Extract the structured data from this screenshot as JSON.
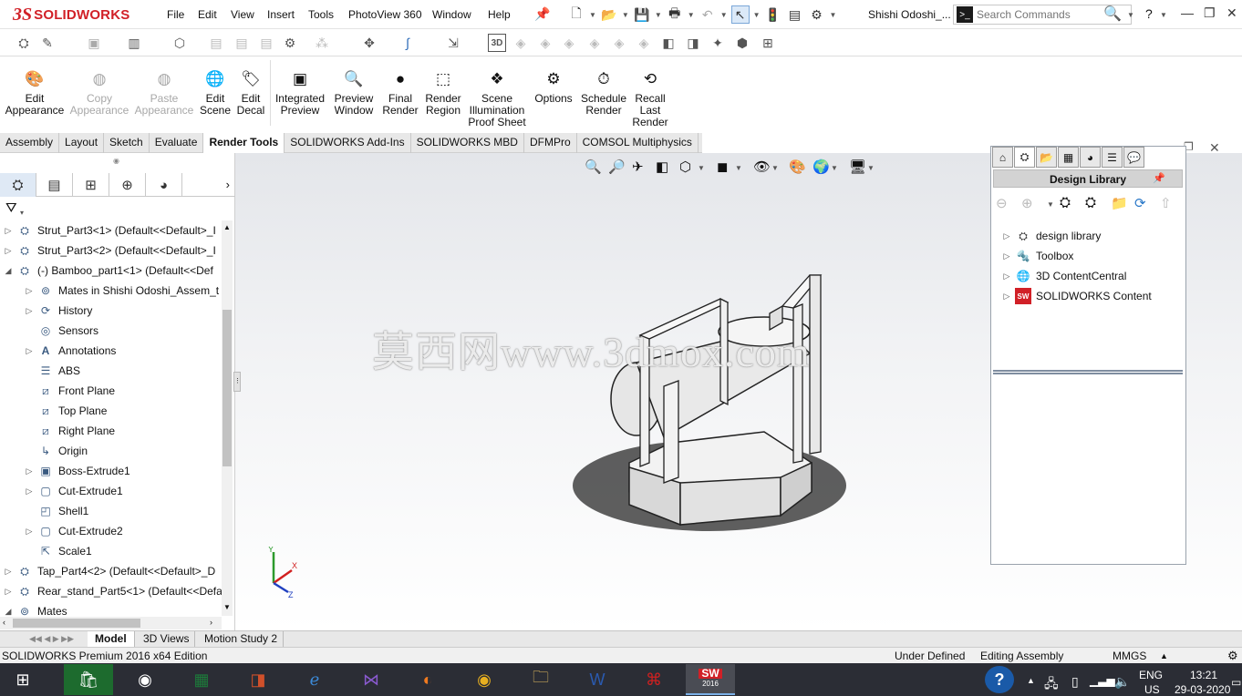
{
  "app": {
    "logo_ds": "3S",
    "logo_text": "SOLIDWORKS"
  },
  "menu": [
    "File",
    "Edit",
    "View",
    "Insert",
    "Tools",
    "PhotoView 360",
    "Window",
    "Help"
  ],
  "document_title": "Shishi Odoshi_...",
  "search": {
    "placeholder": "Search Commands"
  },
  "help": "?",
  "ribbon": [
    {
      "label": "Edit Appearance",
      "enabled": true
    },
    {
      "label": "Copy Appearance",
      "enabled": false
    },
    {
      "label": "Paste Appearance",
      "enabled": false
    },
    {
      "label": "Edit Scene",
      "enabled": true
    },
    {
      "label": "Edit Decal",
      "enabled": true
    },
    {
      "label": "Integrated Preview",
      "enabled": true
    },
    {
      "label": "Preview Window",
      "enabled": true
    },
    {
      "label": "Final Render",
      "enabled": true
    },
    {
      "label": "Render Region",
      "enabled": true
    },
    {
      "label": "Scene Illumination Proof Sheet",
      "enabled": true
    },
    {
      "label": "Options",
      "enabled": true
    },
    {
      "label": "Schedule Render",
      "enabled": true
    },
    {
      "label": "Recall Last Render",
      "enabled": true
    }
  ],
  "command_tabs": [
    "Assembly",
    "Layout",
    "Sketch",
    "Evaluate",
    "Render Tools",
    "SOLIDWORKS Add-Ins",
    "SOLIDWORKS MBD",
    "DFMPro",
    "COMSOL Multiphysics"
  ],
  "active_command_tab": "Render Tools",
  "tree": [
    {
      "label": "Strut_Part3<1> (Default<<Default>_I",
      "level": 0,
      "expand": "right"
    },
    {
      "label": "Strut_Part3<2> (Default<<Default>_I",
      "level": 0,
      "expand": "right"
    },
    {
      "label": "(-) Bamboo_part1<1> (Default<<Def",
      "level": 0,
      "expand": "down"
    },
    {
      "label": "Mates in Shishi Odoshi_Assem_t",
      "level": 1,
      "expand": "right"
    },
    {
      "label": "History",
      "level": 1,
      "expand": "right"
    },
    {
      "label": "Sensors",
      "level": 1,
      "expand": ""
    },
    {
      "label": "Annotations",
      "level": 1,
      "expand": "right"
    },
    {
      "label": "ABS",
      "level": 1,
      "expand": ""
    },
    {
      "label": "Front Plane",
      "level": 1,
      "expand": ""
    },
    {
      "label": "Top Plane",
      "level": 1,
      "expand": ""
    },
    {
      "label": "Right Plane",
      "level": 1,
      "expand": ""
    },
    {
      "label": "Origin",
      "level": 1,
      "expand": ""
    },
    {
      "label": "Boss-Extrude1",
      "level": 1,
      "expand": "right"
    },
    {
      "label": "Cut-Extrude1",
      "level": 1,
      "expand": "right"
    },
    {
      "label": "Shell1",
      "level": 1,
      "expand": ""
    },
    {
      "label": "Cut-Extrude2",
      "level": 1,
      "expand": "right"
    },
    {
      "label": "Scale1",
      "level": 1,
      "expand": ""
    },
    {
      "label": "Tap_Part4<2> (Default<<Default>_D",
      "level": 0,
      "expand": "right"
    },
    {
      "label": "Rear_stand_Part5<1> (Default<<Defa",
      "level": 0,
      "expand": "right"
    },
    {
      "label": "Mates",
      "level": 0,
      "expand": "down"
    }
  ],
  "design_library": {
    "title": "Design Library",
    "items": [
      "design library",
      "Toolbox",
      "3D ContentCentral",
      "SOLIDWORKS Content"
    ]
  },
  "bottom_tabs": [
    "Model",
    "3D Views",
    "Motion Study 2"
  ],
  "active_bottom_tab": "Model",
  "status": {
    "edition": "SOLIDWORKS Premium 2016 x64 Edition",
    "state": "Under Defined",
    "mode": "Editing Assembly",
    "units": "MMGS"
  },
  "watermark": "莫西网www.3dmox.com",
  "triad": {
    "x": "X",
    "y": "Y",
    "z": "Z"
  },
  "taskbar": {
    "lang1": "ENG",
    "lang2": "US",
    "time": "13:21",
    "date": "29-03-2020",
    "sw_badge": "2016"
  }
}
